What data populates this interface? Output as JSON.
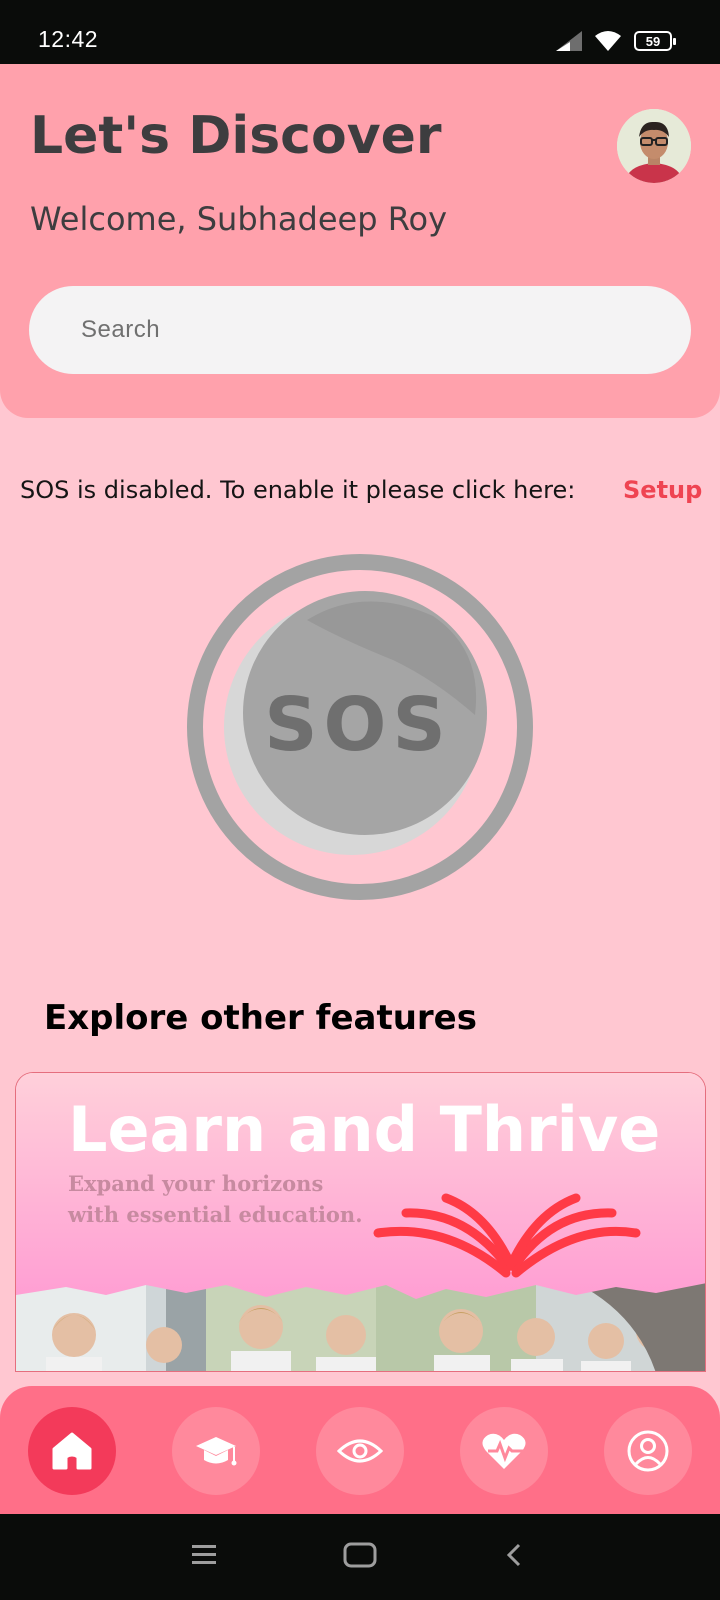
{
  "status": {
    "time": "12:42",
    "battery": "59"
  },
  "header": {
    "title": "Let's Discover",
    "welcome": "Welcome, Subhadeep Roy",
    "search_placeholder": "Search"
  },
  "sos": {
    "notice": "SOS is disabled. To enable it please click here:",
    "setup_label": "Setup",
    "button_label": "SOS"
  },
  "explore": {
    "title": "Explore other features",
    "banner": {
      "title": "Learn and Thrive",
      "subtitle_line1": "Expand your horizons",
      "subtitle_line2": "with essential education."
    }
  },
  "nav": [
    {
      "name": "home",
      "icon": "home-icon",
      "active": true
    },
    {
      "name": "education",
      "icon": "graduation-cap-icon",
      "active": false
    },
    {
      "name": "view",
      "icon": "eye-icon",
      "active": false
    },
    {
      "name": "health",
      "icon": "heart-pulse-icon",
      "active": false
    },
    {
      "name": "profile",
      "icon": "user-circle-icon",
      "active": false
    }
  ],
  "colors": {
    "page_bg": "#ffc7d1",
    "header_bg": "#ffa1ac",
    "accent": "#ef4452",
    "nav_bg": "#ff6f88",
    "nav_active": "#f33a5a"
  }
}
